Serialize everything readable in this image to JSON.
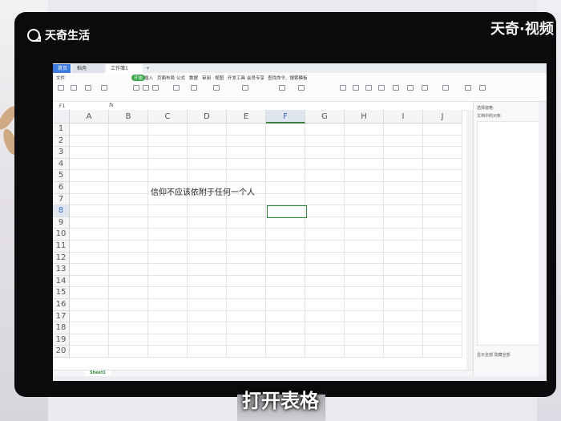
{
  "overlay": {
    "brand": "天奇生活",
    "watermark": "天奇·视频",
    "caption": "打开表格"
  },
  "window": {
    "tabs": [
      "首页",
      "稻壳",
      "工作簿1"
    ],
    "add_tab": "+"
  },
  "menu": {
    "items": [
      "文件",
      "开始",
      "插入",
      "页面布局",
      "公式",
      "数据",
      "审阅",
      "视图",
      "开发工具",
      "会员专享",
      "查找命令、搜索模板"
    ],
    "active": "开始"
  },
  "formula_bar": {
    "name_box": "F1",
    "fx": "fx"
  },
  "sheet": {
    "columns": [
      "A",
      "B",
      "C",
      "D",
      "E",
      "F",
      "G",
      "H",
      "I",
      "J"
    ],
    "rows": [
      "1",
      "2",
      "3",
      "4",
      "5",
      "6",
      "7",
      "8",
      "9",
      "10",
      "11",
      "12",
      "13",
      "14",
      "15",
      "16",
      "17",
      "18",
      "19",
      "20"
    ],
    "selected_column": "F",
    "selected_row": "8",
    "cell_text": "信仰不应该依附于任何一个人",
    "tab_name": "Sheet1"
  },
  "side_pane": {
    "title": "选择窗格",
    "subtitle": "文档中的对象",
    "footer": "显示全部  隐藏全部"
  },
  "colors": {
    "accent_green": "#2f8a3b",
    "tab_blue": "#3f7ce0"
  }
}
